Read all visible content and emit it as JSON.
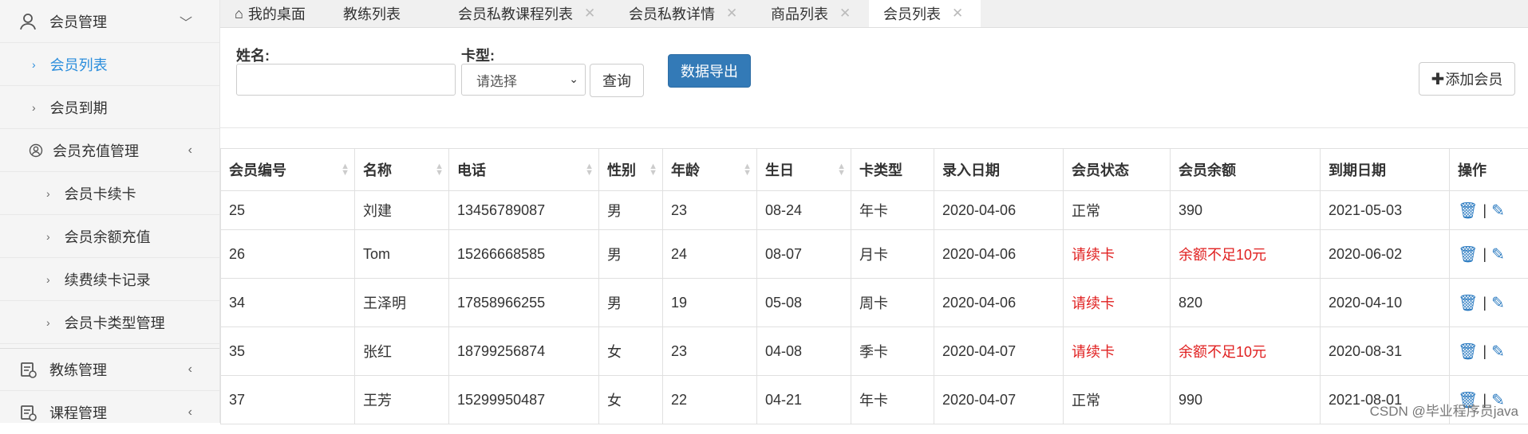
{
  "sidebar": {
    "items": [
      {
        "label": "会员管理",
        "level": 0
      },
      {
        "label": "会员列表",
        "level": 1,
        "active": true
      },
      {
        "label": "会员到期",
        "level": 1
      },
      {
        "label": "会员充值管理",
        "level": 1
      },
      {
        "label": "会员卡续卡",
        "level": 2
      },
      {
        "label": "会员余额充值",
        "level": 2
      },
      {
        "label": "续费续卡记录",
        "level": 2
      },
      {
        "label": "会员卡类型管理",
        "level": 2
      },
      {
        "label": "教练管理",
        "level": 0
      },
      {
        "label": "课程管理",
        "level": 0
      }
    ]
  },
  "tabs": [
    {
      "label": "我的桌面",
      "icon": "home-icon"
    },
    {
      "label": "教练列表"
    },
    {
      "label": "会员私教课程列表",
      "closable": true
    },
    {
      "label": "会员私教详情",
      "closable": true
    },
    {
      "label": "商品列表",
      "closable": true
    },
    {
      "label": "会员列表",
      "closable": true,
      "active": true
    }
  ],
  "search": {
    "name_label": "姓名:",
    "name_value": "",
    "card_label": "卡型:",
    "card_select": "请选择",
    "query_button": "查询",
    "export_button": "数据导出",
    "add_button": "添加会员"
  },
  "table": {
    "headers": [
      "会员编号",
      "名称",
      "电话",
      "性别",
      "年龄",
      "生日",
      "卡类型",
      "录入日期",
      "会员状态",
      "会员余额",
      "到期日期",
      "操作"
    ],
    "rows": [
      [
        "25",
        "刘建",
        "13456789087",
        "男",
        "23",
        "08-24",
        "年卡",
        "2020-04-06",
        "正常",
        "390",
        "2021-05-03"
      ],
      [
        "26",
        "Tom",
        "15266668585",
        "男",
        "24",
        "08-07",
        "月卡",
        "2020-04-06",
        "请续卡",
        "余额不足10元",
        "2020-06-02"
      ],
      [
        "34",
        "王泽明",
        "17858966255",
        "男",
        "19",
        "05-08",
        "周卡",
        "2020-04-06",
        "请续卡",
        "820",
        "2020-04-10"
      ],
      [
        "35",
        "张红",
        "18799256874",
        "女",
        "23",
        "04-08",
        "季卡",
        "2020-04-07",
        "请续卡",
        "余额不足10元",
        "2020-08-31"
      ],
      [
        "37",
        "王芳",
        "15299950487",
        "女",
        "22",
        "04-21",
        "年卡",
        "2020-04-07",
        "正常",
        "990",
        "2021-08-01"
      ]
    ],
    "action_separator": "|"
  },
  "watermark": "CSDN @毕业程序员java",
  "colors": {
    "accent": "#337ab7",
    "active_text": "#2a8ddc",
    "warning": "#e02020"
  }
}
